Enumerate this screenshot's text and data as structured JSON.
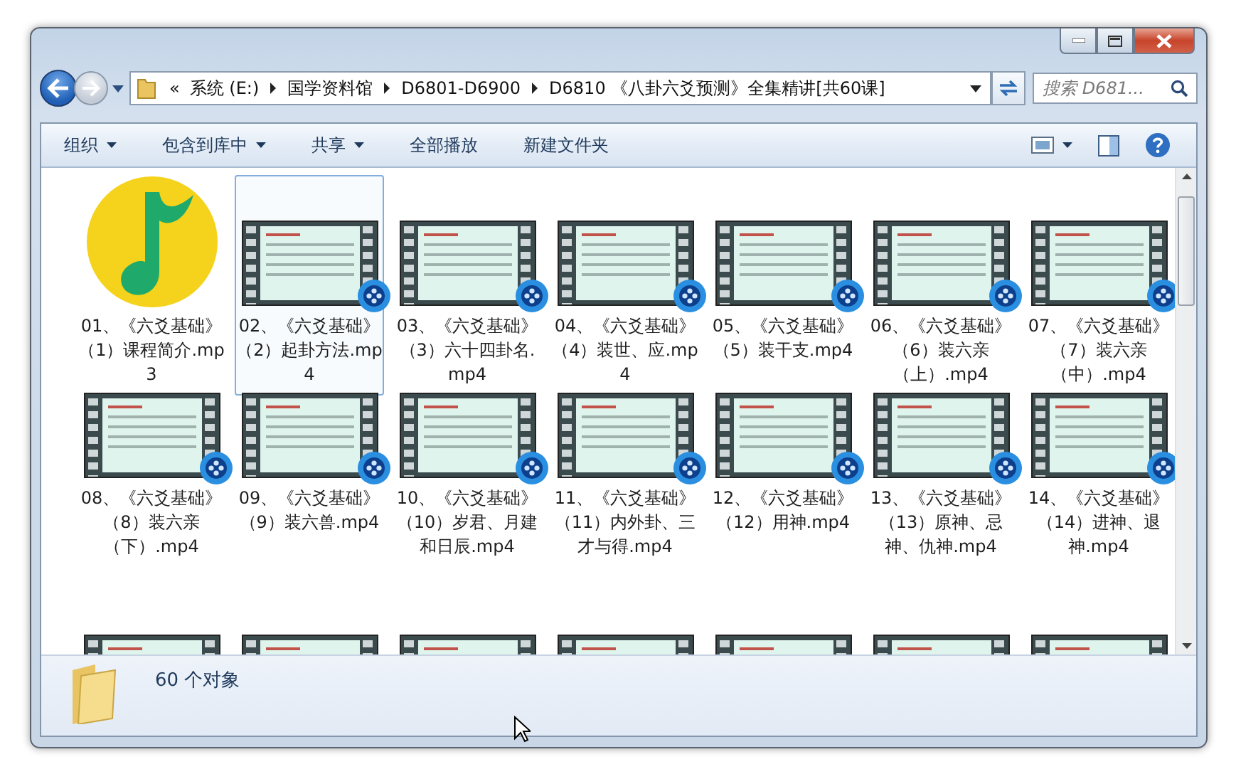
{
  "address_bar": {
    "overflow": "«",
    "path": [
      "系统 (E:)",
      "国学资料馆",
      "D6801-D6900",
      "D6810 《八卦六爻预测》全集精讲[共60课]"
    ]
  },
  "search": {
    "placeholder": "搜索 D681..."
  },
  "toolbar": [
    {
      "label": "组织",
      "dropdown": true
    },
    {
      "label": "包含到库中",
      "dropdown": true
    },
    {
      "label": "共享",
      "dropdown": true
    },
    {
      "label": "全部播放",
      "dropdown": false
    },
    {
      "label": "新建文件夹",
      "dropdown": false
    }
  ],
  "files": [
    {
      "kind": "audio",
      "name": "01、《六爻基础》（1）课程简介.mp3",
      "selected": false
    },
    {
      "kind": "video",
      "name": "02、《六爻基础》（2）起卦方法.mp4",
      "selected": true
    },
    {
      "kind": "video",
      "name": "03、《六爻基础》（3）六十四卦名.mp4",
      "selected": false
    },
    {
      "kind": "video",
      "name": "04、《六爻基础》（4）装世、应.mp4",
      "selected": false
    },
    {
      "kind": "video",
      "name": "05、《六爻基础》（5）装干支.mp4",
      "selected": false
    },
    {
      "kind": "video",
      "name": "06、《六爻基础》（6）装六亲（上）.mp4",
      "selected": false
    },
    {
      "kind": "video",
      "name": "07、《六爻基础》（7）装六亲（中）.mp4",
      "selected": false
    },
    {
      "kind": "video",
      "name": "08、《六爻基础》（8）装六亲（下）.mp4",
      "selected": false
    },
    {
      "kind": "video",
      "name": "09、《六爻基础》（9）装六兽.mp4",
      "selected": false
    },
    {
      "kind": "video",
      "name": "10、《六爻基础》（10）岁君、月建和日辰.mp4",
      "selected": false
    },
    {
      "kind": "video",
      "name": "11、《六爻基础》（11）内外卦、三才与得.mp4",
      "selected": false
    },
    {
      "kind": "video",
      "name": "12、《六爻基础》（12）用神.mp4",
      "selected": false
    },
    {
      "kind": "video",
      "name": "13、《六爻基础》（13）原神、忌神、仇神.mp4",
      "selected": false
    },
    {
      "kind": "video",
      "name": "14、《六爻基础》（14）进神、退神.mp4",
      "selected": false
    },
    {
      "kind": "video",
      "selected": false
    },
    {
      "kind": "video",
      "selected": false
    },
    {
      "kind": "video",
      "selected": false
    },
    {
      "kind": "video",
      "selected": false
    },
    {
      "kind": "video",
      "selected": false
    },
    {
      "kind": "video",
      "selected": false
    },
    {
      "kind": "video",
      "selected": false
    }
  ],
  "status_bar": {
    "count": "60 个对象"
  }
}
